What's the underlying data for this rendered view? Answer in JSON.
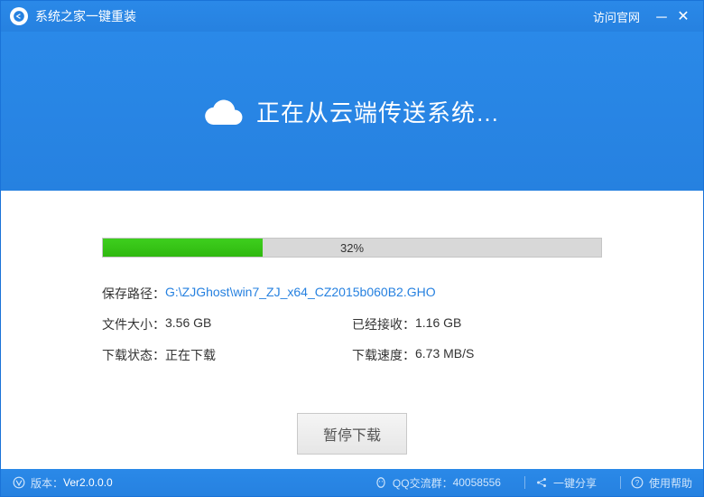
{
  "titlebar": {
    "app_name": "系统之家一键重装",
    "visit_link": "访问官网"
  },
  "hero": {
    "headline": "正在从云端传送系统…"
  },
  "progress": {
    "percent_text": "32%",
    "percent_value": 32
  },
  "info": {
    "save_path_label": "保存路径：",
    "save_path_value": "G:\\ZJGhost\\win7_ZJ_x64_CZ2015b060B2.GHO",
    "file_size_label": "文件大小：",
    "file_size_value": "3.56 GB",
    "received_label": "已经接收：",
    "received_value": "1.16 GB",
    "status_label": "下载状态：",
    "status_value": "正在下载",
    "speed_label": "下载速度：",
    "speed_value": "6.73 MB/S"
  },
  "buttons": {
    "pause": "暂停下载"
  },
  "footer": {
    "version_label": "版本：",
    "version_value": "Ver2.0.0.0",
    "qq_label": "QQ交流群：",
    "qq_value": "40058556",
    "share": "一键分享",
    "help": "使用帮助"
  }
}
